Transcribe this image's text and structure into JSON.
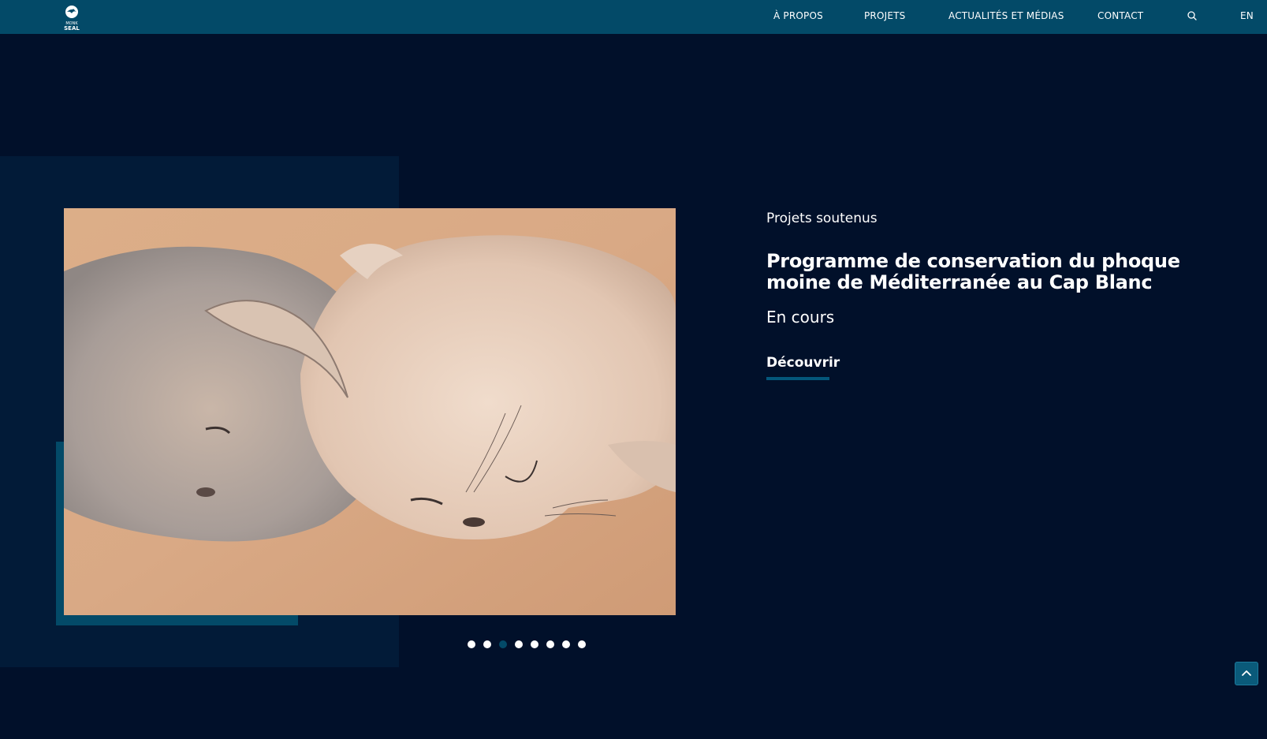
{
  "brand": {
    "logo_text_line1": "MONK",
    "logo_text_line2": "SEAL"
  },
  "nav": {
    "items": [
      {
        "label": "À PROPOS"
      },
      {
        "label": "PROJETS"
      },
      {
        "label": "ACTUALITÉS ET MÉDIAS"
      },
      {
        "label": "CONTACT"
      }
    ],
    "search_icon": "search-icon",
    "language": "EN"
  },
  "hero": {
    "eyebrow": "Projets soutenus",
    "title": "Programme de conservation du phoque moine de Méditerranée au Cap Blanc",
    "status": "En cours",
    "cta_label": "Découvrir",
    "image_icon": "monk-seals-photo",
    "carousel": {
      "total": 8,
      "active_index": 2
    }
  },
  "scroll_top_icon": "chevron-up-icon",
  "colors": {
    "background": "#01102a",
    "navbar": "#034a68",
    "panel": "#021b38",
    "accent": "#034a68"
  }
}
